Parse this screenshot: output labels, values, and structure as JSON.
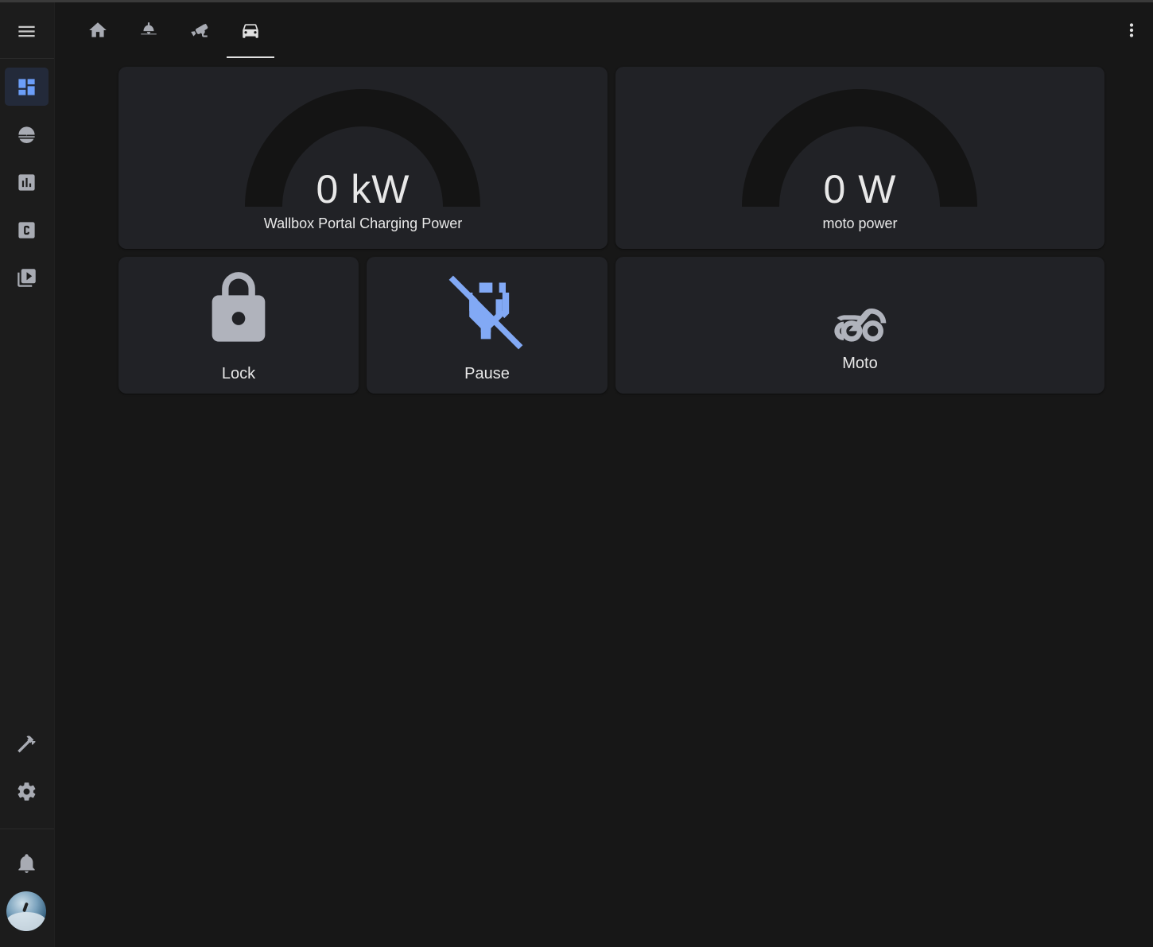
{
  "sidebar": {
    "items": [
      {
        "icon": "menu-icon"
      },
      {
        "icon": "dashboard-icon",
        "active": true
      },
      {
        "icon": "energy-icon"
      },
      {
        "icon": "history-icon"
      },
      {
        "icon": "calendar-c-icon"
      },
      {
        "icon": "media-icon"
      },
      {
        "icon": "developer-tools-icon"
      },
      {
        "icon": "settings-icon"
      },
      {
        "icon": "notifications-icon"
      },
      {
        "icon": "user-avatar"
      }
    ]
  },
  "header": {
    "tabs": [
      {
        "icon": "home-icon"
      },
      {
        "icon": "ceiling-light-icon"
      },
      {
        "icon": "cctv-icon"
      },
      {
        "icon": "car-icon",
        "active": true
      }
    ],
    "menu_icon": "dots-vertical-icon"
  },
  "cards": {
    "gauge1": {
      "value_text": "0 kW",
      "value": 0,
      "name": "Wallbox Portal Charging Power"
    },
    "gauge2": {
      "value_text": "0 W",
      "value": 0,
      "name": "moto power"
    },
    "lock": {
      "label": "Lock",
      "icon": "lock-icon",
      "icon_color": "#b0b3bc"
    },
    "pause": {
      "label": "Pause",
      "icon": "power-plug-off-icon",
      "icon_color": "#82a9f5"
    },
    "moto": {
      "label": "Moto",
      "icon": "motorbike-icon",
      "icon_color": "#b0b3bc"
    }
  },
  "colors": {
    "background": "#171717",
    "card": "#212226",
    "sidebar": "#1c1c1c",
    "accent": "#6c9ef8",
    "gauge_track": "#141414",
    "icon_grey": "#a8abb3"
  }
}
